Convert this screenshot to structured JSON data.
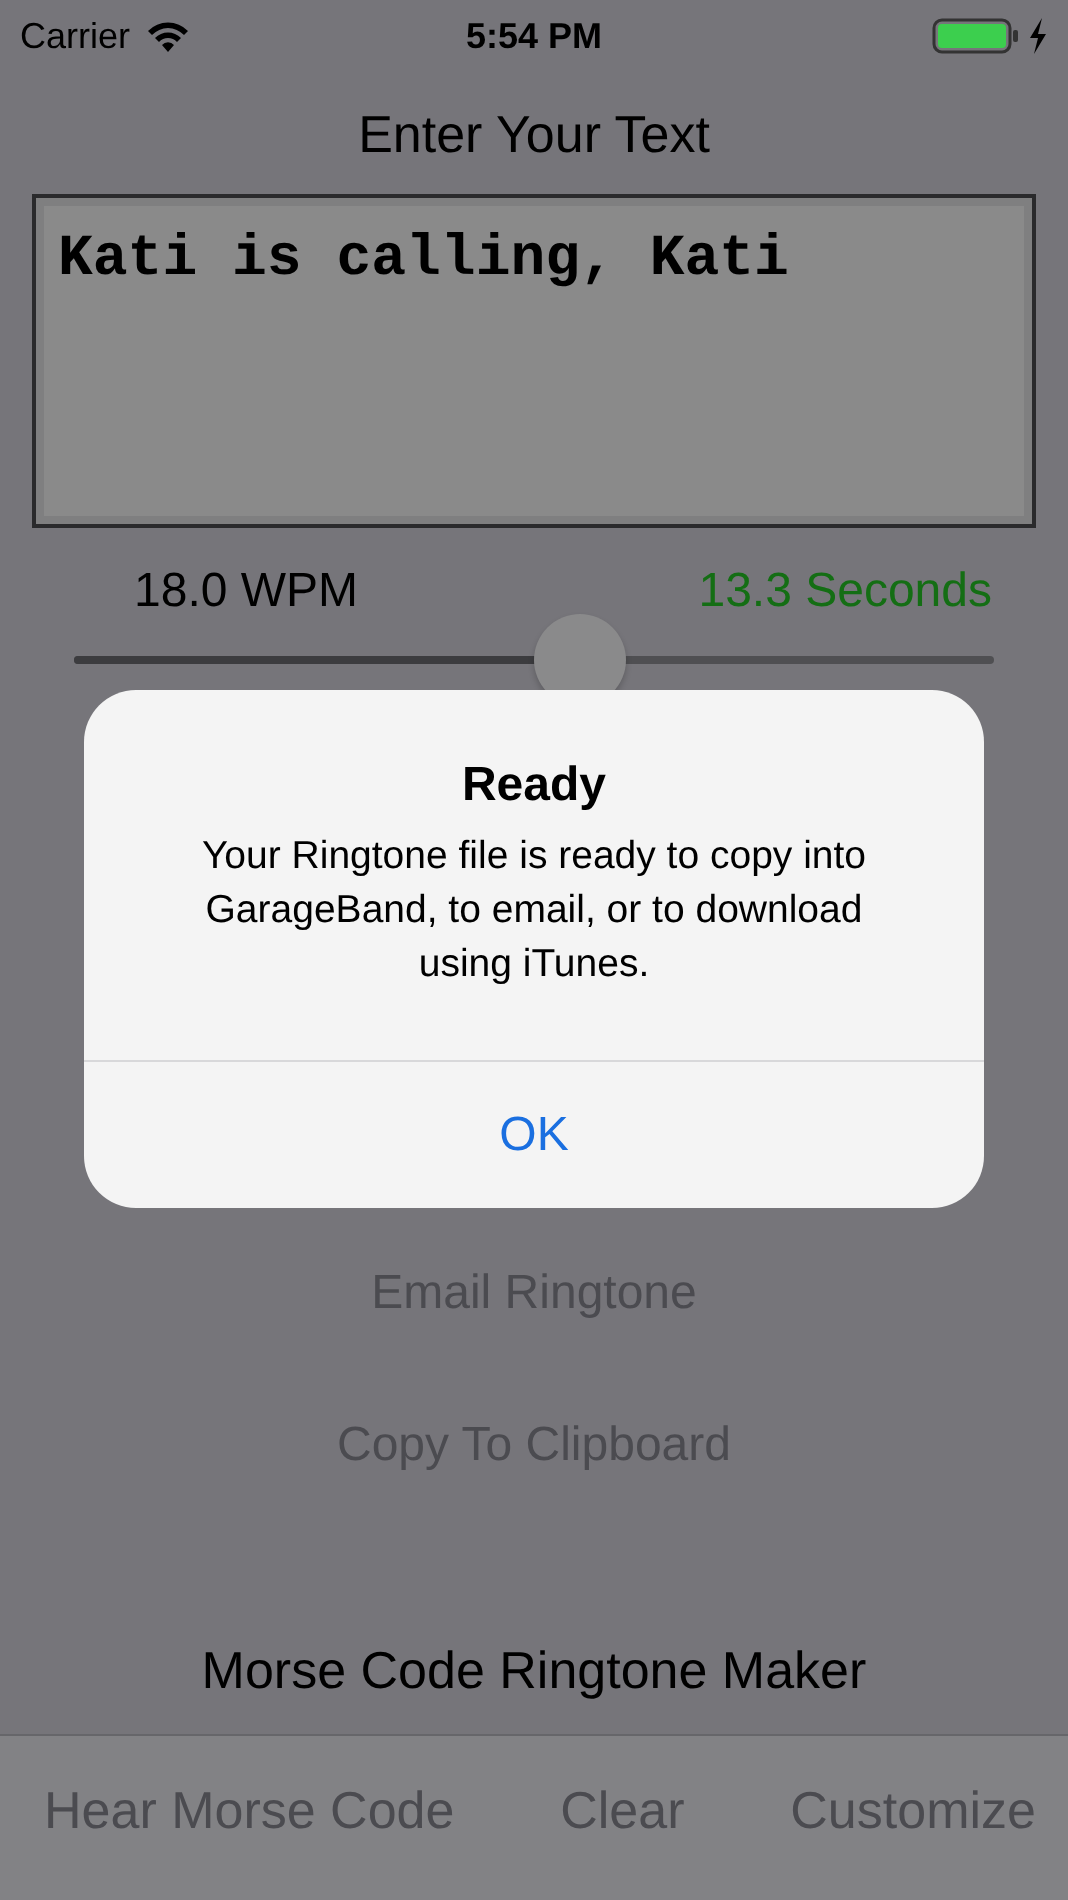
{
  "status_bar": {
    "carrier": "Carrier",
    "time": "5:54 PM"
  },
  "title": "Enter Your Text",
  "text_input": {
    "value": "Kati is calling, Kati"
  },
  "speed": {
    "wpm": "18.0 WPM",
    "duration": "13.3 Seconds",
    "level": 0.55
  },
  "actions": [
    "Email Ringtone",
    "Copy To Clipboard"
  ],
  "app_name": "Morse Code Ringtone Maker",
  "toolbar": [
    "Hear Morse Code",
    "Clear",
    "Customize"
  ],
  "alert": {
    "title": "Ready",
    "message": "Your Ringtone file is ready to copy into GarageBand, to email, or to download using iTunes.",
    "buttons": [
      "OK"
    ]
  }
}
